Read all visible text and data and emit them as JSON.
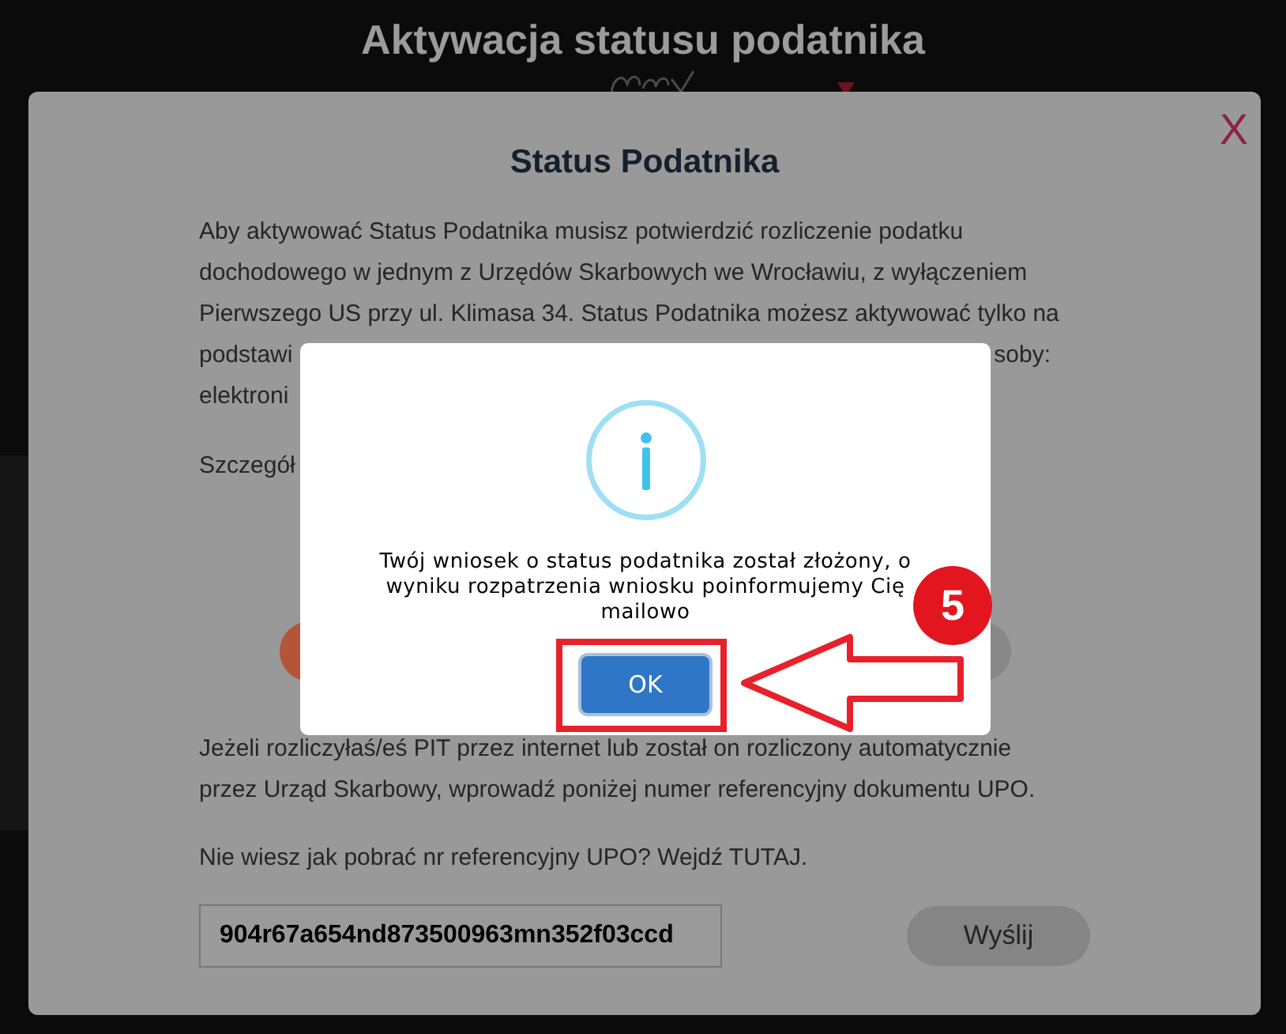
{
  "page": {
    "title": "Aktywacja statusu podatnika",
    "nav": [
      {
        "kind": "logo"
      },
      {
        "kind": "caret"
      }
    ]
  },
  "modal": {
    "close_label": "X",
    "title": "Status Podatnika",
    "intro_lines": [
      "Aby aktywować Status Podatnika musisz potwierdzić rozliczenie podatku",
      "dochodowego w jednym z Urzędów Skarbowych we Wrocławiu, z wyłączeniem",
      "Pierwszego US przy ul. Klimasa 34. Status Podatnika możesz aktywować tylko na"
    ],
    "partial_lines": [
      {
        "left": "podstawi",
        "right": "soby:"
      },
      {
        "left": "elektroni"
      }
    ],
    "details_fragment": "Szczegół",
    "partial_buttons": [
      {
        "color": "#b4553a"
      },
      {
        "color": "#888888"
      }
    ],
    "upo_info_lines": [
      "Jeżeli rozliczyłaś/eś PIT przez internet lub został on rozliczony automatycznie",
      "przez Urząd Skarbowy, wprowadź poniżej numer referencyjny dokumentu UPO."
    ],
    "upo_help": "Nie wiesz jak pobrać nr referencyjny UPO? Wejdź TUTAJ.",
    "reference_field": {
      "value": "904r67a654nd873500963mn352f03ccd"
    },
    "submit_button": "Wyślij"
  },
  "alert": {
    "message": "Twój wniosek o status podatnika został złożony, o wyniku rozpatrzenia wniosku poinformujemy Cię mailowo",
    "confirm_button": "OK"
  },
  "annotation": {
    "step": "5"
  }
}
